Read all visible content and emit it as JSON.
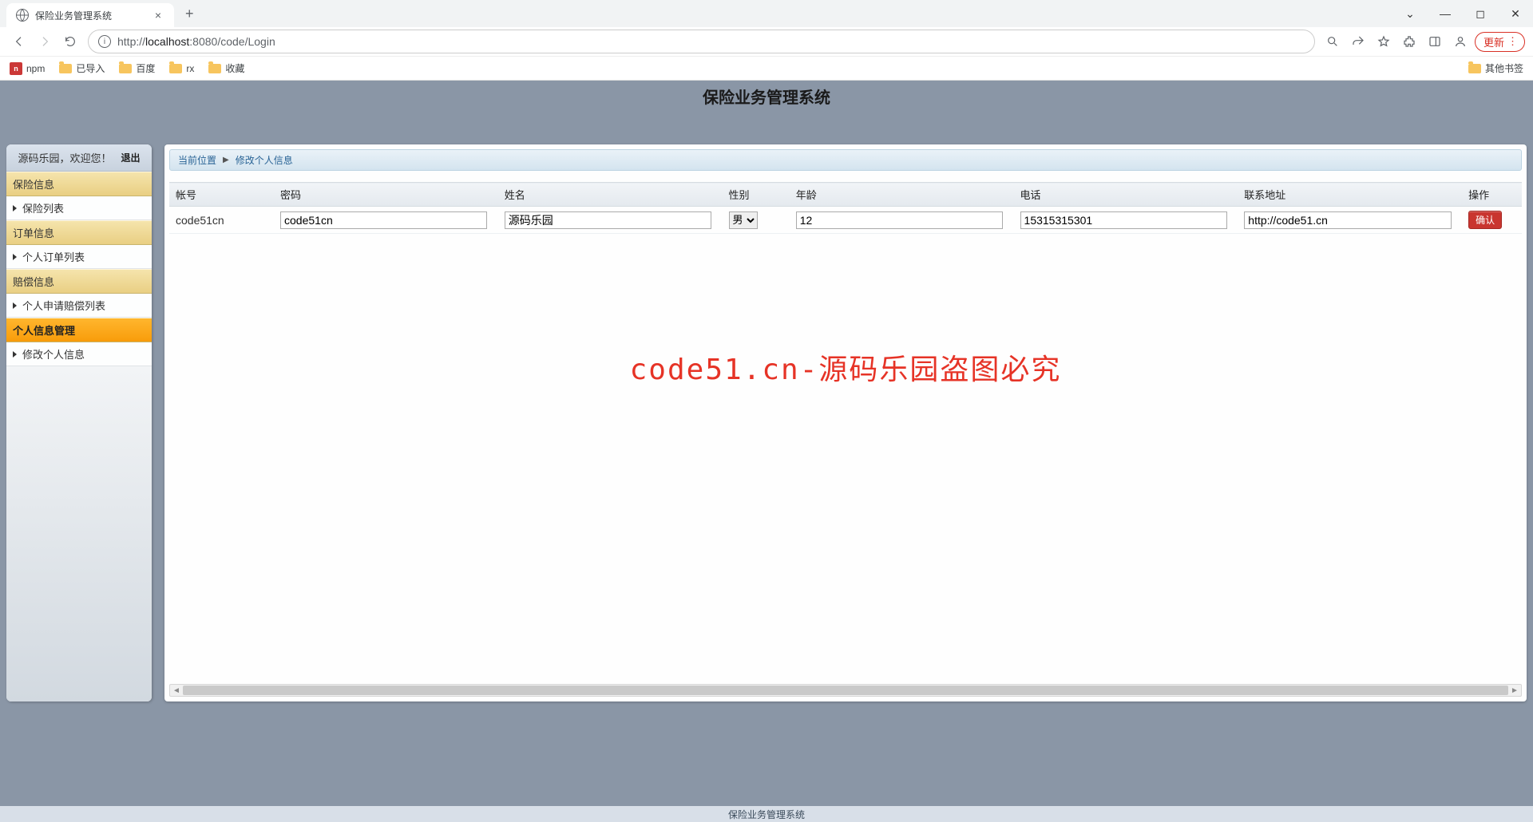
{
  "browser": {
    "tab_title": "保险业务管理系统",
    "url_prefix": "http://",
    "url_host": "localhost",
    "url_port": ":8080",
    "url_path": "/code/Login",
    "update_label": "更新",
    "bookmarks": {
      "npm": "npm",
      "imported": "已导入",
      "baidu": "百度",
      "rx": "rx",
      "fav": "收藏",
      "other": "其他书签"
    }
  },
  "app": {
    "title": "保险业务管理系统",
    "footer": "保险业务管理系统"
  },
  "sidebar": {
    "welcome": "源码乐园，欢迎您！",
    "logout": "退出",
    "cat_insurance": "保险信息",
    "item_insurance_list": "保险列表",
    "cat_order": "订单信息",
    "item_personal_orders": "个人订单列表",
    "cat_claim": "赔偿信息",
    "item_personal_claims": "个人申请赔偿列表",
    "cat_profile": "个人信息管理",
    "item_edit_profile": "修改个人信息"
  },
  "breadcrumb": {
    "label": "当前位置",
    "current": "修改个人信息"
  },
  "table": {
    "headers": {
      "account": "帐号",
      "password": "密码",
      "name": "姓名",
      "gender": "性别",
      "age": "年龄",
      "phone": "电话",
      "address": "联系地址",
      "action": "操作"
    },
    "row": {
      "account": "code51cn",
      "password": "code51cn",
      "name": "源码乐园",
      "gender": "男",
      "age": "12",
      "phone": "15315315301",
      "address": "http://code51.cn",
      "confirm": "确认"
    }
  },
  "watermark": "code51.cn-源码乐园盗图必究"
}
